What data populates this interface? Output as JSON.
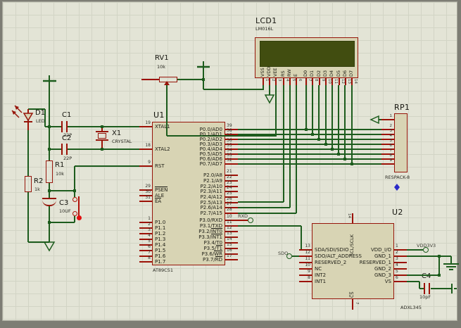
{
  "colors": {
    "wire": "#1d5c1d",
    "pin_stub": "#9c1106",
    "component_outline": "#96150a",
    "chip_fill": "#d8d4b4",
    "lcd_screen": "#414d10",
    "sheet_bg": "#e3e4d6",
    "marker_blue": "#2a2ac8",
    "marker_red": "#e21010"
  },
  "u1": {
    "ref": "U1",
    "part": "AT89C51",
    "left_pins": [
      {
        "num": "19",
        "name": "XTAL1"
      },
      {
        "num": "18",
        "name": "XTAL2"
      },
      {
        "num": "9",
        "name": "RST"
      },
      {
        "num": "29",
        "ov": "PSEN"
      },
      {
        "num": "30",
        "name": "ALE"
      },
      {
        "num": "31",
        "ov": "EA"
      },
      {
        "num": "1",
        "name": "P1.0"
      },
      {
        "num": "2",
        "name": "P1.1"
      },
      {
        "num": "3",
        "name": "P1.2"
      },
      {
        "num": "4",
        "name": "P1.3"
      },
      {
        "num": "5",
        "name": "P1.4"
      },
      {
        "num": "6",
        "name": "P1.5"
      },
      {
        "num": "7",
        "name": "P1.6"
      },
      {
        "num": "8",
        "name": "P1.7"
      }
    ],
    "right_pins": [
      {
        "num": "39",
        "name": "P0.0/AD0"
      },
      {
        "num": "38",
        "name": "P0.1/AD1"
      },
      {
        "num": "37",
        "name": "P0.2/AD2"
      },
      {
        "num": "36",
        "name": "P0.3/AD3"
      },
      {
        "num": "35",
        "name": "P0.4/AD4"
      },
      {
        "num": "34",
        "name": "P0.5/AD5"
      },
      {
        "num": "33",
        "name": "P0.6/AD6"
      },
      {
        "num": "32",
        "name": "P0.7/AD7"
      },
      {
        "num": "21",
        "name": "P2.0/A8"
      },
      {
        "num": "22",
        "name": "P2.1/A9"
      },
      {
        "num": "23",
        "name": "P2.2/A10"
      },
      {
        "num": "24",
        "name": "P2.3/A11"
      },
      {
        "num": "25",
        "name": "P2.4/A12"
      },
      {
        "num": "26",
        "name": "P2.5/A13"
      },
      {
        "num": "27",
        "name": "P2.6/A14"
      },
      {
        "num": "28",
        "name": "P2.7/A15"
      },
      {
        "num": "10",
        "name": "P3.0/RXD"
      },
      {
        "num": "11",
        "name": "P3.1/TXD"
      },
      {
        "num": "12",
        "pre": "P3.2/",
        "ov": "INT0"
      },
      {
        "num": "13",
        "pre": "P3.3/",
        "ov": "INT1"
      },
      {
        "num": "14",
        "name": "P3.4/T0"
      },
      {
        "num": "15",
        "pre": "P3.5/",
        "ov": "T1"
      },
      {
        "num": "16",
        "pre": "P3.6/",
        "ov": "WR"
      },
      {
        "num": "17",
        "pre": "P3.7/",
        "ov": "RD"
      }
    ]
  },
  "lcd1": {
    "ref": "LCD1",
    "part": "LM016L",
    "pins": [
      {
        "num": "1",
        "name": "VSS"
      },
      {
        "num": "2",
        "name": "VDD"
      },
      {
        "num": "3",
        "name": "VEE"
      },
      {
        "num": "4",
        "name": "RS"
      },
      {
        "num": "5",
        "name": "RW"
      },
      {
        "num": "6",
        "name": "E"
      },
      {
        "num": "7",
        "name": "D0"
      },
      {
        "num": "8",
        "name": "D1"
      },
      {
        "num": "9",
        "name": "D2"
      },
      {
        "num": "10",
        "name": "D3"
      },
      {
        "num": "11",
        "name": "D4"
      },
      {
        "num": "12",
        "name": "D5"
      },
      {
        "num": "13",
        "name": "D6"
      },
      {
        "num": "14",
        "name": "D7"
      }
    ]
  },
  "rp1": {
    "ref": "RP1",
    "part": "RESPACK-8",
    "pin_numbers": [
      "1",
      "2",
      "3",
      "4",
      "5",
      "6",
      "7",
      "8",
      "9"
    ]
  },
  "u2": {
    "ref": "U2",
    "part": "ADXL345",
    "top_pin": {
      "num": "14",
      "name": "SCL/SCLK"
    },
    "bottom_pin": {
      "num": "7",
      "name": "CS",
      "ov": true
    },
    "left_pins": [
      {
        "num": "13",
        "name": "SDA/SDI/SDIO"
      },
      {
        "num": "12",
        "name": "SDO/ALT_ADDRESS"
      },
      {
        "num": "11",
        "name": "RESERVED_2"
      },
      {
        "num": "10",
        "name": "NC"
      },
      {
        "num": "9",
        "name": "INT2"
      },
      {
        "num": "8",
        "name": "INT1"
      }
    ],
    "right_pins": [
      {
        "num": "1",
        "name": "VDD_I/O"
      },
      {
        "num": "2",
        "name": "GND_1"
      },
      {
        "num": "3",
        "name": "RESERVED_1"
      },
      {
        "num": "4",
        "name": "GND_2"
      },
      {
        "num": "5",
        "name": "GND_3"
      },
      {
        "num": "6",
        "name": "VS"
      }
    ]
  },
  "rv1": {
    "ref": "RV1",
    "value": "10k"
  },
  "r1": {
    "ref": "R1",
    "value": "10k"
  },
  "r2": {
    "ref": "R2",
    "value": "1k"
  },
  "c1": {
    "ref": "C1",
    "value": "22P"
  },
  "c2": {
    "ref": "C2",
    "value": "22P"
  },
  "c3": {
    "ref": "C3",
    "value": "10UF"
  },
  "c4": {
    "ref": "C4",
    "value": "10pF"
  },
  "d1": {
    "ref": "D1",
    "part": "LED"
  },
  "x1": {
    "ref": "X1",
    "part": "CRYSTAL"
  },
  "net_labels": {
    "rxd": "RXD",
    "sdo": "SDO",
    "vdd": "VDD3V3"
  }
}
